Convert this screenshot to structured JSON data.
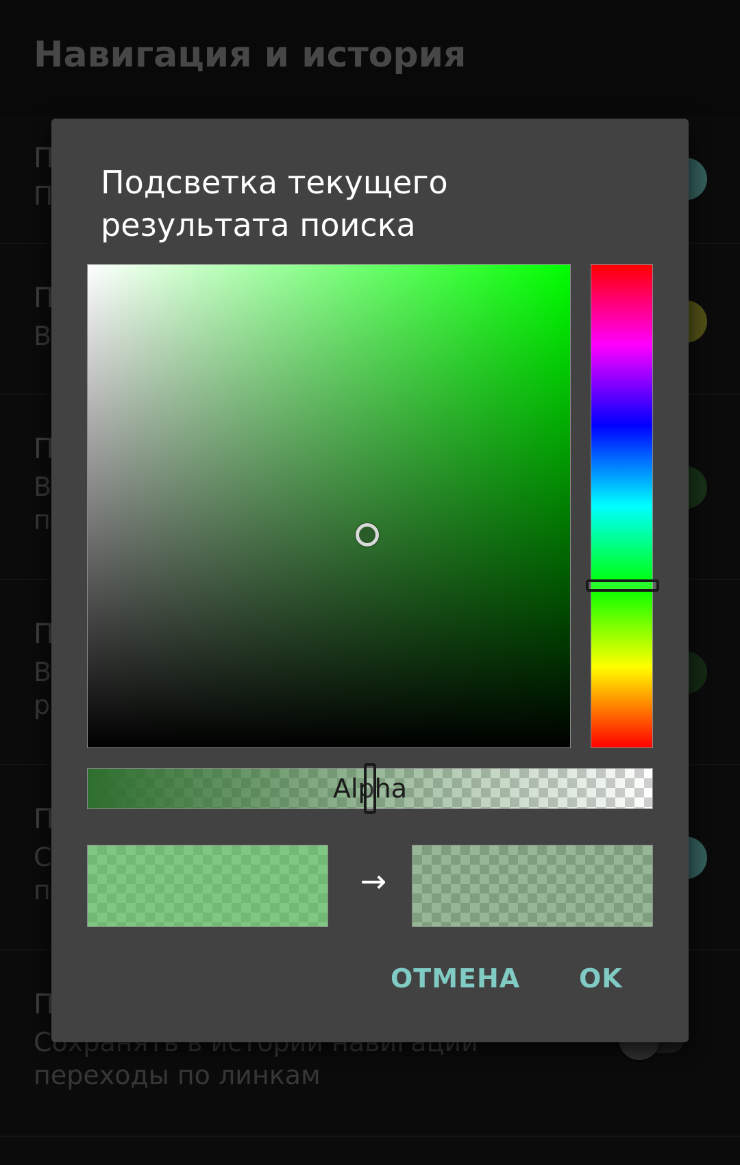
{
  "screen": {
    "title": "Навигация и история"
  },
  "settings_rows": [
    {
      "title": "П",
      "subtitle": "П",
      "swatch_color": "#4f8f8a"
    },
    {
      "title": "П",
      "subtitle": "В",
      "swatch_color": "#7a7a23"
    },
    {
      "title": "П",
      "subtitle": "В\nп",
      "swatch_color": "#244a24"
    },
    {
      "title": "П",
      "subtitle": "В\nр",
      "swatch_color": "#1f3f1f"
    },
    {
      "title": "П",
      "subtitle": "С\nп",
      "swatch_color": "#4f8f8a"
    },
    {
      "title": "П",
      "subtitle": "Сохранять в истории навигации\nпереходы по линкам",
      "toggle_on": false
    }
  ],
  "dialog": {
    "title": "Подсветка текущего результата поиска",
    "hue_color": "#00ff00",
    "saturation": 0.58,
    "value": 0.44,
    "hue_level": 0.665,
    "alpha_label": "Alpha",
    "alpha_level": 0.5,
    "old_color": "#4caf50",
    "old_alpha": 0.7,
    "new_color": "#2e6e2e",
    "new_alpha": 0.5,
    "arrow": "→",
    "cancel_label": "ОТМЕНА",
    "ok_label": "OK"
  }
}
